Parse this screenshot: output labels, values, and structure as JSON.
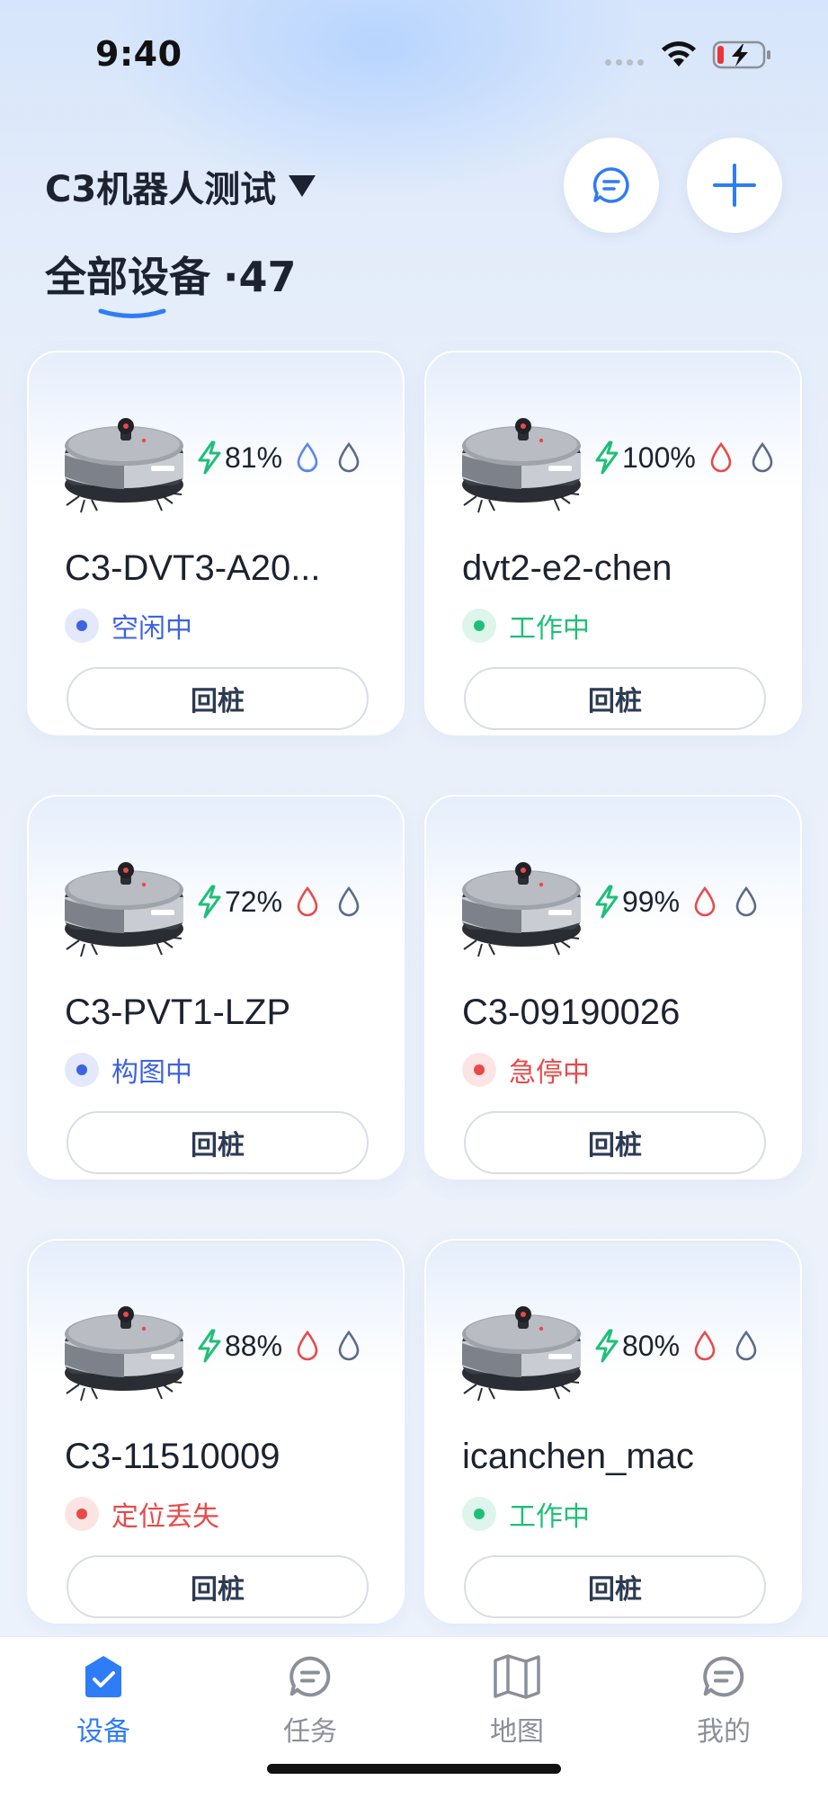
{
  "status_bar": {
    "time": "9:40"
  },
  "header": {
    "title": "C3机器人测试",
    "chat_icon": "chat-bubble-icon",
    "add_icon": "plus-icon"
  },
  "tabs": {
    "label": "全部设备",
    "count": "·47"
  },
  "colors": {
    "accent": "#2e7cf6",
    "bolt": "#1fbf78",
    "status_blue": "#3e62e0",
    "status_green": "#1fbf78",
    "status_red": "#e84a4a"
  },
  "devices": [
    {
      "name": "C3-DVT3-A20...",
      "battery": "81%",
      "status": "空闲中",
      "status_color": "blue",
      "action": "回桩",
      "clean_water": "blue",
      "dirty_water": "outline"
    },
    {
      "name": "dvt2-e2-chen",
      "battery": "100%",
      "status": "工作中",
      "status_color": "green",
      "action": "回桩",
      "clean_water": "red",
      "dirty_water": "outline"
    },
    {
      "name": "C3-PVT1-LZP",
      "battery": "72%",
      "status": "构图中",
      "status_color": "blue",
      "action": "回桩",
      "clean_water": "red",
      "dirty_water": "outline"
    },
    {
      "name": "C3-09190026",
      "battery": "99%",
      "status": "急停中",
      "status_color": "red",
      "action": "回桩",
      "clean_water": "red",
      "dirty_water": "outline"
    },
    {
      "name": "C3-11510009",
      "battery": "88%",
      "status": "定位丢失",
      "status_color": "red",
      "action": "回桩",
      "clean_water": "red",
      "dirty_water": "outline"
    },
    {
      "name": "icanchen_mac",
      "battery": "80%",
      "status": "工作中",
      "status_color": "green",
      "action": "回桩",
      "clean_water": "red",
      "dirty_water": "outline"
    }
  ],
  "bottom_nav": [
    {
      "label": "设备",
      "icon": "device-check-icon",
      "active": true
    },
    {
      "label": "任务",
      "icon": "chat-bubble-icon",
      "active": false
    },
    {
      "label": "地图",
      "icon": "map-icon",
      "active": false
    },
    {
      "label": "我的",
      "icon": "chat-bubble-icon",
      "active": false
    }
  ]
}
